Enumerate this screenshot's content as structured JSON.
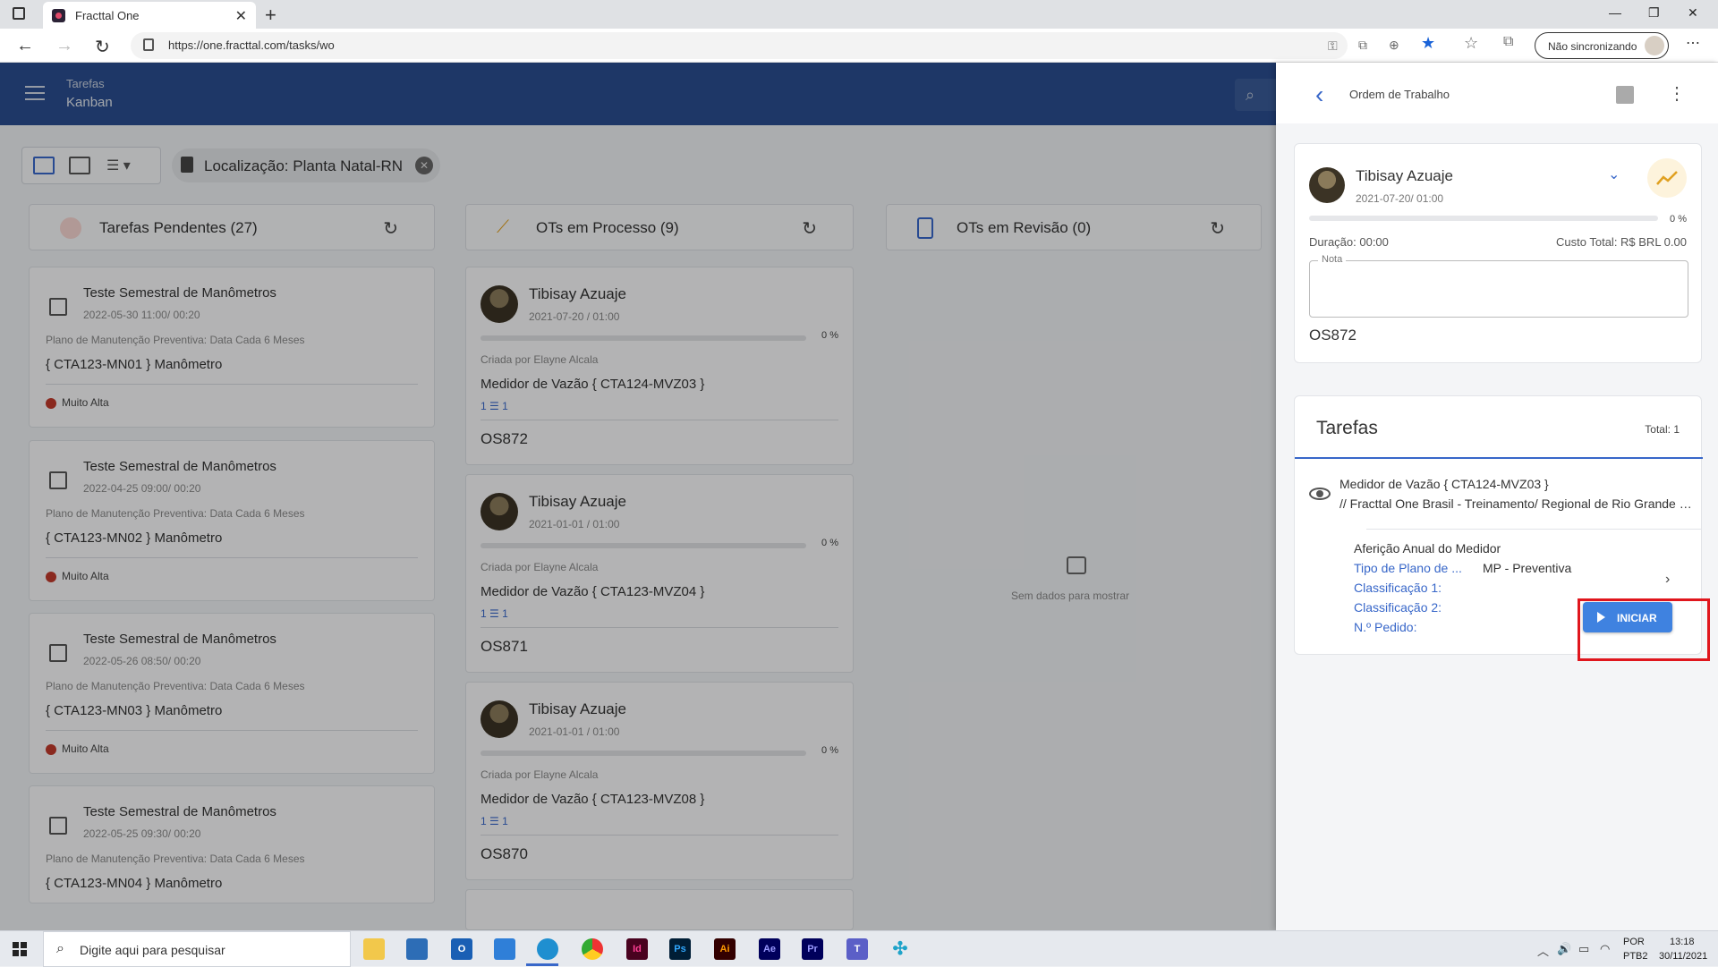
{
  "browser": {
    "tab_title": "Fracttal One",
    "url": "https://one.fracttal.com/tasks/wo",
    "sync_label": "Não sincronizando"
  },
  "header": {
    "title": "Tarefas",
    "subtitle": "Kanban"
  },
  "filter": {
    "label": "Localização: Planta Natal-RN"
  },
  "columns": [
    {
      "title": "Tarefas Pendentes (27)"
    },
    {
      "title": "OTs em Processo (9)"
    },
    {
      "title": "OTs em Revisão (0)"
    }
  ],
  "pending_cards": [
    {
      "title": "Teste Semestral de Manômetros",
      "date": "2022-05-30 11:00/ 00:20",
      "plan": "Plano de Manutenção Preventiva: Data Cada 6 Meses",
      "asset": "{ CTA123-MN01 } Manômetro",
      "priority": "Muito Alta"
    },
    {
      "title": "Teste Semestral de Manômetros",
      "date": "2022-04-25 09:00/ 00:20",
      "plan": "Plano de Manutenção Preventiva: Data Cada 6 Meses",
      "asset": "{ CTA123-MN02 } Manômetro",
      "priority": "Muito Alta"
    },
    {
      "title": "Teste Semestral de Manômetros",
      "date": "2022-05-26 08:50/ 00:20",
      "plan": "Plano de Manutenção Preventiva: Data Cada 6 Meses",
      "asset": "{ CTA123-MN03 } Manômetro",
      "priority": "Muito Alta"
    },
    {
      "title": "Teste Semestral de Manômetros",
      "date": "2022-05-25 09:30/ 00:20",
      "plan": "Plano de Manutenção Preventiva: Data Cada 6 Meses",
      "asset": "{ CTA123-MN04 } Manômetro",
      "priority": ""
    }
  ],
  "process_cards": [
    {
      "name": "Tibisay Azuaje",
      "date": "2021-07-20 / 01:00",
      "progress": "0 %",
      "created_by": "Criada por Elayne Alcala",
      "equipment": "Medidor de Vazão { CTA124-MVZ03 }",
      "counts": "1 ☰ 1",
      "os": "OS872"
    },
    {
      "name": "Tibisay Azuaje",
      "date": "2021-01-01 / 01:00",
      "progress": "0 %",
      "created_by": "Criada por Elayne Alcala",
      "equipment": "Medidor de Vazão { CTA123-MVZ04 }",
      "counts": "1 ☰ 1",
      "os": "OS871"
    },
    {
      "name": "Tibisay Azuaje",
      "date": "2021-01-01 / 01:00",
      "progress": "0 %",
      "created_by": "Criada por Elayne Alcala",
      "equipment": "Medidor de Vazão { CTA123-MVZ08 }",
      "counts": "1 ☰ 1",
      "os": "OS870"
    }
  ],
  "review_empty": "Sem dados para mostrar",
  "panel": {
    "title": "Ordem de Trabalho",
    "assignee": "Tibisay Azuaje",
    "date": "2021-07-20/ 01:00",
    "progress": "0 %",
    "duration": "Duração: 00:00",
    "cost": "Custo Total: R$ BRL 0.00",
    "note_label": "Nota",
    "os": "OS872",
    "tasks_title": "Tarefas",
    "tasks_total": "Total: 1",
    "asset_name": "Medidor de Vazão { CTA124-MVZ03 }",
    "asset_path": "// Fracttal One Brasil - Treinamento/ Regional de Rio Grande do Norte",
    "task_name": "Aferição Anual do Medidor",
    "plan_type_label": "Tipo de Plano de ...",
    "plan_type_value": "MP - Preventiva",
    "class1_label": "Classificação 1:",
    "class2_label": "Classificação 2:",
    "order_label": "N.º Pedido:",
    "start_button": "INICIAR"
  },
  "taskbar": {
    "search_placeholder": "Digite aqui para pesquisar",
    "lang1": "POR",
    "lang2": "PTB2",
    "time": "13:18",
    "date": "30/11/2021"
  },
  "colors": {
    "header": "#2a4d8f",
    "accent": "#3867c9",
    "start_button": "#3f82e0",
    "highlight": "#e0161d",
    "priority": "#c0392b"
  }
}
